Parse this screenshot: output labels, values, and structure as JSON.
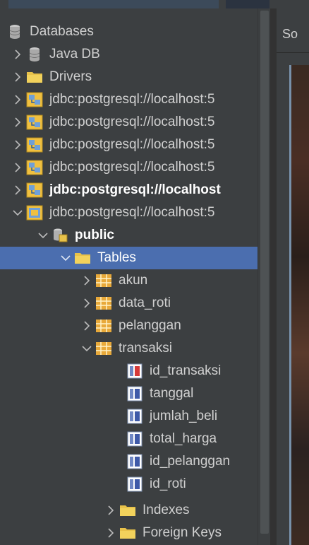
{
  "right_panel": {
    "tab_label": "So"
  },
  "tree": {
    "databases_label": "Databases",
    "java_db_label": "Java DB",
    "drivers_label": "Drivers",
    "connections": [
      "jdbc:postgresql://localhost:5",
      "jdbc:postgresql://localhost:5",
      "jdbc:postgresql://localhost:5",
      "jdbc:postgresql://localhost:5",
      "jdbc:postgresql://localhost",
      "jdbc:postgresql://localhost:5"
    ],
    "schema_label": "public",
    "tables_label": "Tables",
    "tables": [
      "akun",
      "data_roti",
      "pelanggan",
      "transaksi"
    ],
    "columns": [
      "id_transaksi",
      "tanggal",
      "jumlah_beli",
      "total_harga",
      "id_pelanggan",
      "id_roti"
    ],
    "indexes_label": "Indexes",
    "foreign_keys_label": "Foreign Keys"
  },
  "colors": {
    "background": "#3c3f41",
    "selection": "#4b6eaf",
    "folder": "#e8c24a",
    "table_icon": "#e8a93a"
  }
}
